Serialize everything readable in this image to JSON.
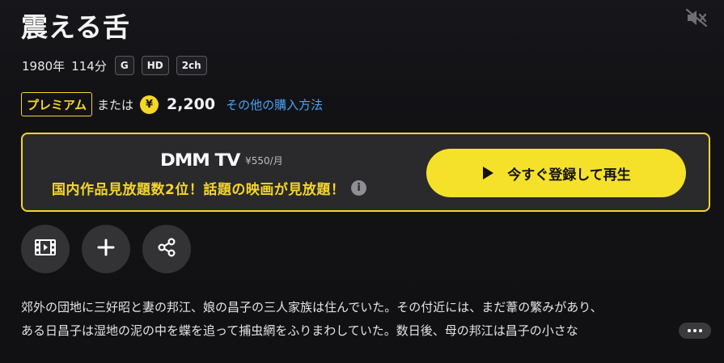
{
  "title": "震える舌",
  "meta": {
    "year": "1980年",
    "duration": "114分",
    "rating": "G",
    "quality": "HD",
    "audio": "2ch"
  },
  "pricing": {
    "premium_label": "プレミアム",
    "or_text": "または",
    "currency_icon": "¥",
    "price": "2,200",
    "other_methods_link": "その他の購入方法"
  },
  "promo": {
    "logo_text": "DMM TV",
    "monthly_price": "¥550/月",
    "catchphrase": "国内作品見放題数2位！話題の映画が見放題！",
    "cta_label": "今すぐ登録して再生"
  },
  "actions": [
    {
      "icon": "film-icon"
    },
    {
      "icon": "plus-icon"
    },
    {
      "icon": "share-icon"
    }
  ],
  "synopsis": {
    "line1": "郊外の団地に三好昭と妻の邦江、娘の昌子の三人家族は住んでいた。その付近には、まだ葦の繁みがあり、",
    "line2": "ある日昌子は湿地の泥の中を蝶を追って捕虫網をふりまわしていた。数日後、母の邦江は昌子の小さな"
  },
  "colors": {
    "accent_yellow": "#f5d629",
    "link_blue": "#4aa3f0",
    "background": "#111114"
  }
}
